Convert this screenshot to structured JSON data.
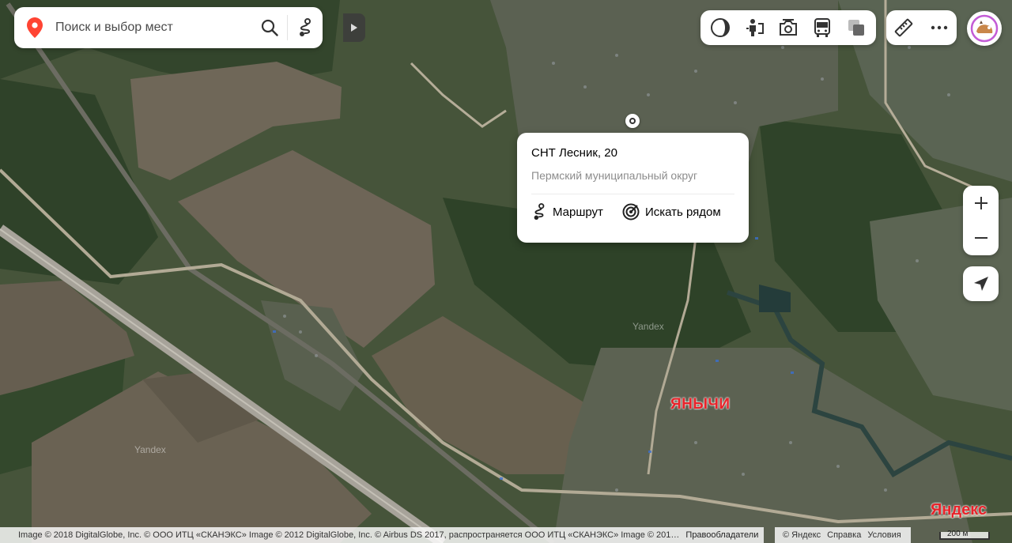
{
  "search": {
    "placeholder": "Поиск и выбор мест"
  },
  "popup": {
    "title": "СНТ Лесник, 20",
    "subtitle": "Пермский муниципальный округ",
    "route_label": "Маршрут",
    "nearby_label": "Искать рядом"
  },
  "map": {
    "place_label": "ЯНЫЧИ",
    "watermark": "Yandex",
    "brand": "Яндекс"
  },
  "copyright": {
    "text": "Image © 2018 DigitalGlobe, Inc. © ООО ИТЦ «СКАНЭКС» Image © 2012 DigitalGlobe, Inc. © Airbus DS 2017, распространяется ООО ИТЦ «СКАНЭКС» Image © 201…",
    "rights_link": "Правообладатели"
  },
  "footer": {
    "yandex": "© Яндекс",
    "help": "Справка",
    "terms": "Условия"
  },
  "scale": {
    "label": "200 м"
  },
  "icons": {
    "search_pin": "map-pin-icon",
    "route": "route-icon",
    "layers": [
      "traffic-icon",
      "panorama-icon",
      "photo-icon",
      "transit-icon",
      "map-layers-icon"
    ],
    "tools": [
      "ruler-icon",
      "more-icon"
    ],
    "zoom_in": "plus-icon",
    "zoom_out": "minus-icon",
    "geolocation": "location-arrow-icon"
  },
  "colors": {
    "accent_red": "#e8232a",
    "pin_red": "#f43"
  }
}
